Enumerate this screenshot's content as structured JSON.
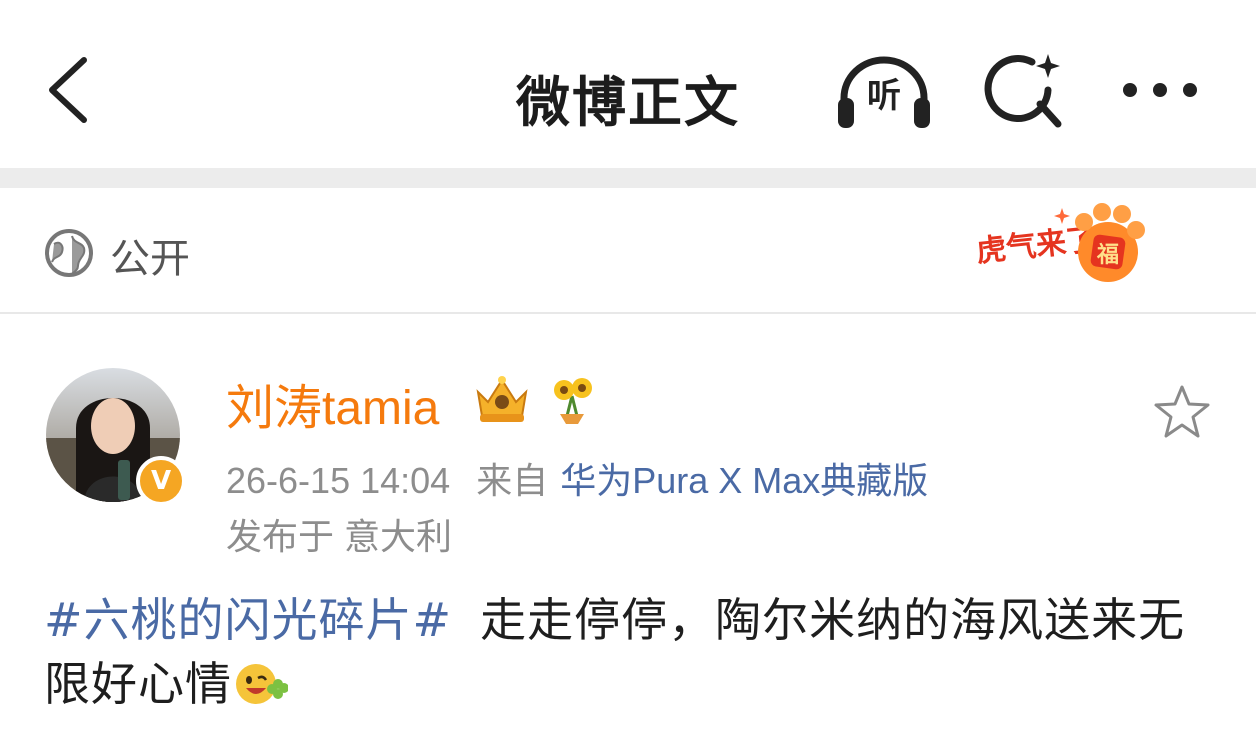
{
  "navbar": {
    "title": "微博正文",
    "listen_label": "听"
  },
  "visibility": {
    "label": "公开",
    "badge_text": "虎气来了",
    "badge_char": "福"
  },
  "post": {
    "author": "刘涛tamia",
    "verified_mark": "V",
    "timestamp": "26-6-15 14:04",
    "source_label": "来自",
    "device": "华为Pura X Max典藏版",
    "location": "发布于 意大利",
    "hashtag": "#六桃的闪光碎片#",
    "text": "走走停停，陶尔米纳的海风送来无限好心情"
  },
  "colors": {
    "brand_orange": "#f57a0d",
    "link_blue": "#4a6aa5",
    "meta_gray": "#8d8d8d",
    "verified_gold": "#f5a623"
  }
}
